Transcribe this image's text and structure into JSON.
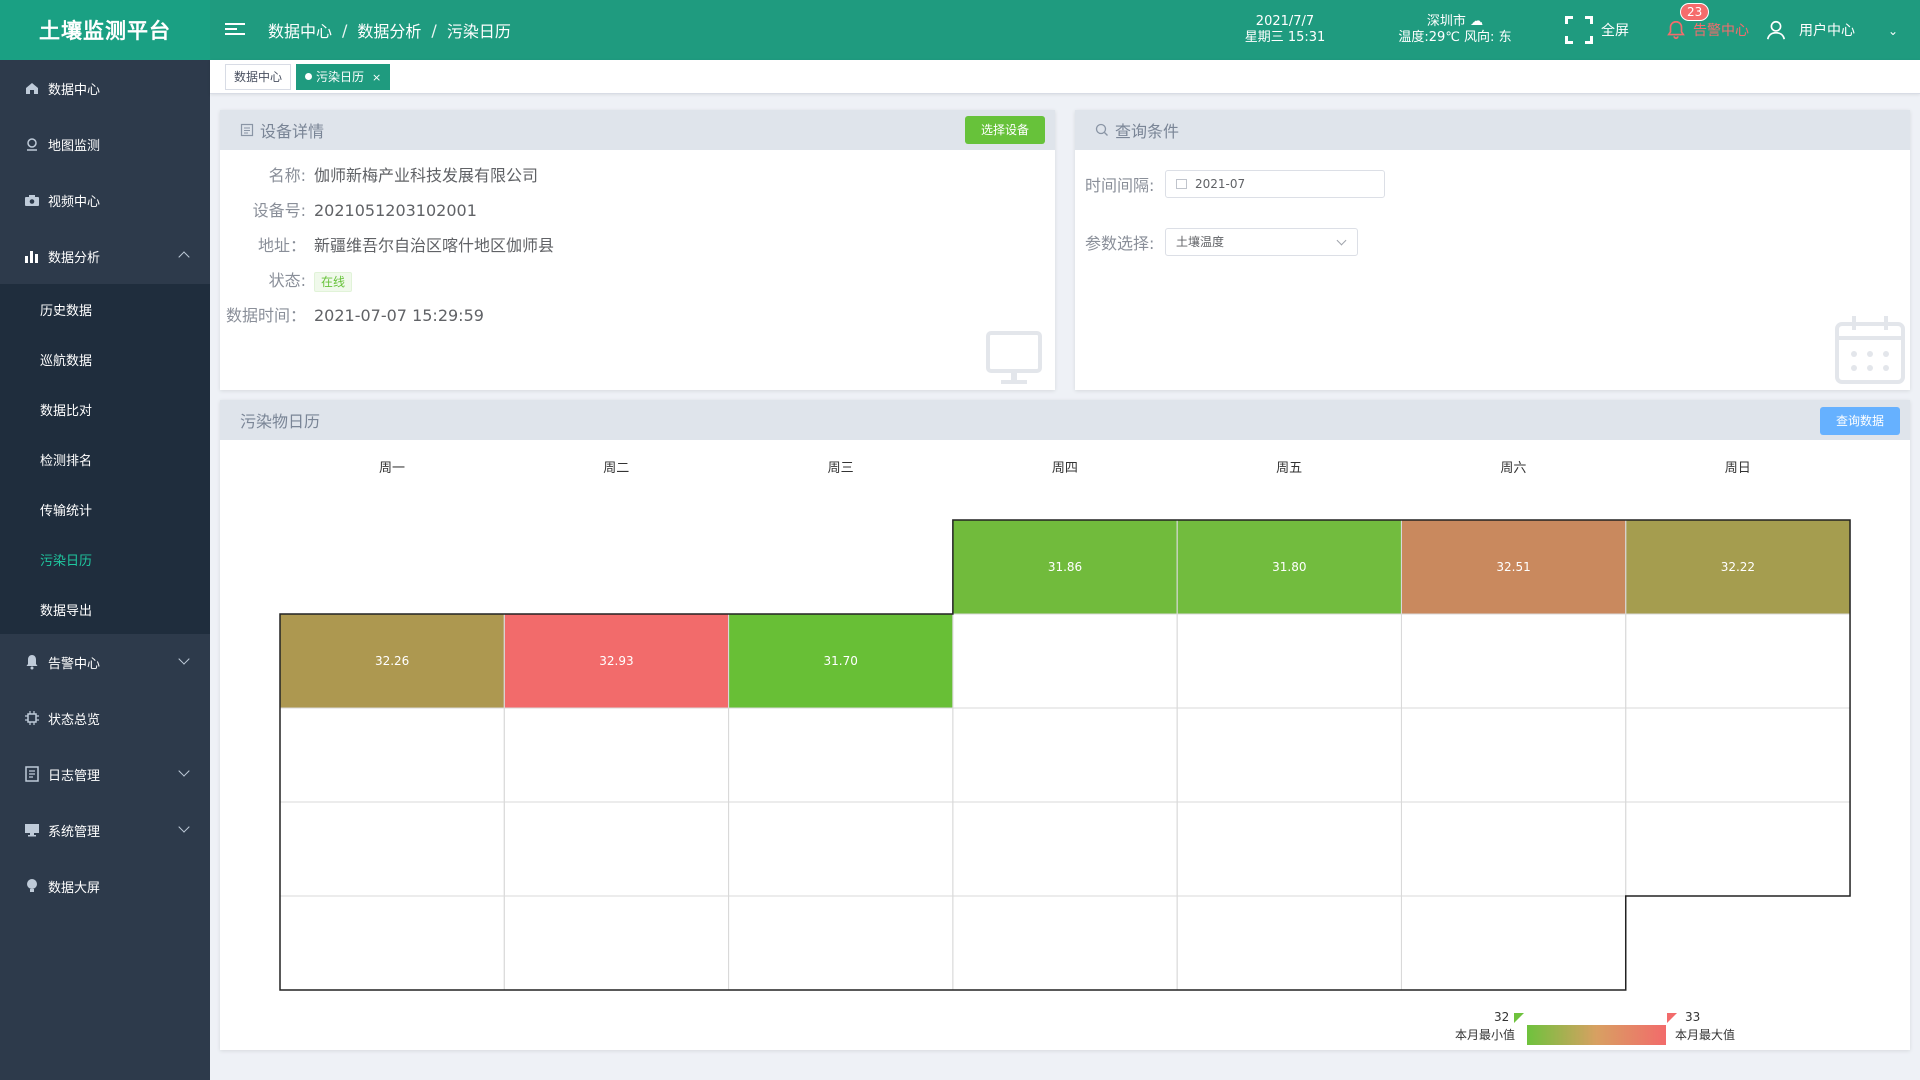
{
  "header": {
    "app_title": "土壤监测平台",
    "breadcrumbs": [
      "数据中心",
      "数据分析",
      "污染日历"
    ],
    "date": "2021/7/7",
    "weekday_time": "星期三 15:31",
    "city": "深圳市",
    "weather": "温度:29℃ 风向: 东",
    "fullscreen_label": "全屏",
    "alarm_label": "告警中心",
    "alarm_count": "23",
    "user_label": "用户中心"
  },
  "sidebar": {
    "items": [
      {
        "label": "数据中心",
        "icon": "home-icon"
      },
      {
        "label": "地图监测",
        "icon": "map-pin-icon"
      },
      {
        "label": "视频中心",
        "icon": "camera-icon"
      },
      {
        "label": "数据分析",
        "icon": "bar-chart-icon",
        "expanded": true
      }
    ],
    "sub_items": [
      "历史数据",
      "巡航数据",
      "数据比对",
      "检测排名",
      "传输统计",
      "污染日历",
      "数据导出"
    ],
    "active_sub": "污染日历",
    "items_after": [
      {
        "label": "告警中心",
        "icon": "bell-icon"
      },
      {
        "label": "状态总览",
        "icon": "chip-icon"
      },
      {
        "label": "日志管理",
        "icon": "log-icon"
      },
      {
        "label": "系统管理",
        "icon": "monitor-icon"
      },
      {
        "label": "数据大屏",
        "icon": "bulb-icon"
      }
    ]
  },
  "tabs": [
    {
      "label": "数据中心",
      "active": false
    },
    {
      "label": "污染日历",
      "active": true,
      "close": "×"
    }
  ],
  "device": {
    "title": "设备详情",
    "select_button": "选择设备",
    "fields": [
      {
        "label": "名称:",
        "value": "伽师新梅产业科技发展有限公司"
      },
      {
        "label": "设备号:",
        "value": "2021051203102001"
      },
      {
        "label": "地址：",
        "value": "新疆维吾尔自治区喀什地区伽师县"
      },
      {
        "label": "状态:",
        "value": "在线"
      },
      {
        "label": "数据时间：",
        "value": "2021-07-07 15:29:59"
      }
    ]
  },
  "query": {
    "title": "查询条件",
    "interval_label": "时间间隔:",
    "interval_value": "2021-07",
    "param_label": "参数选择:",
    "param_value": "土壤温度"
  },
  "calendar": {
    "title": "污染物日历",
    "query_button": "查询数据",
    "weekdays": [
      "周一",
      "周二",
      "周三",
      "周四",
      "周五",
      "周六",
      "周日"
    ],
    "first_weekday_index": 3,
    "days_in_month": 31,
    "values": [
      31.86,
      31.8,
      32.51,
      32.22,
      32.26,
      32.93,
      31.7
    ],
    "colors": [
      "#71bb3c",
      "#72bc3e",
      "#c9895e",
      "#a59d4f",
      "#ad9850",
      "#f26b6b",
      "#68bf36"
    ],
    "legend": {
      "min_value": "32",
      "min_label": "本月最小值",
      "max_value": "33",
      "max_label": "本月最大值",
      "min_color": "#6ec23d",
      "max_color": "#f26b6b"
    }
  }
}
